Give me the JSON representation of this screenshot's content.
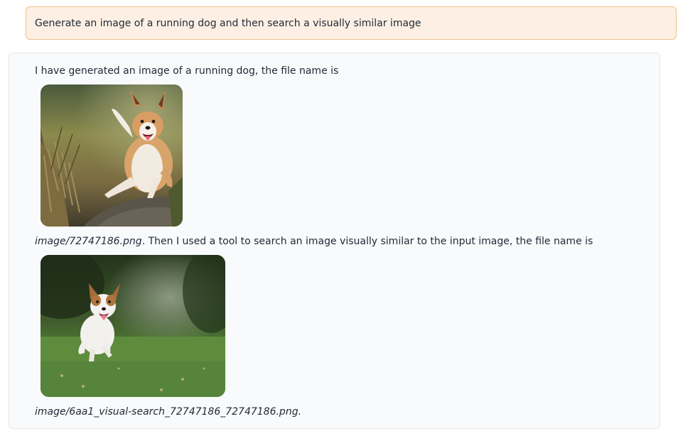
{
  "user_message": {
    "text": "Generate an image of a running dog and then search a visually similar image"
  },
  "assistant_message": {
    "intro_text": "I have generated an image of a running dog, the file name is",
    "generated_image": {
      "file_name": "image/72747186.png",
      "subject": "running dog on a dirt path"
    },
    "middle_text": " Then I used a tool to search an image visually similar to the input image, the file name is",
    "similar_image": {
      "file_name": "image/6aa1_visual-search_72747186_72747186.png",
      "subject": "running dog on grass"
    },
    "end_punctuation": "."
  },
  "colors": {
    "user_bubble_bg": "#fdefe3",
    "user_bubble_border": "#f3bf8f",
    "assistant_bubble_bg": "#f9fafb",
    "assistant_bubble_border": "#e5e7eb"
  }
}
